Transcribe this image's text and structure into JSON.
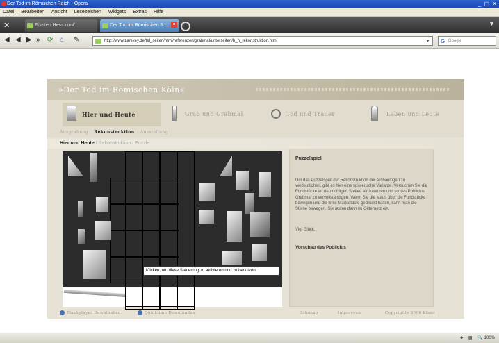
{
  "window": {
    "title": "Der Tod im Römischen Reich - Opera",
    "controls": "_ ▢ ✕"
  },
  "menubar": [
    "Datei",
    "Bearbeiten",
    "Ansicht",
    "Lesezeichen",
    "Widgets",
    "Extras",
    "Hilfe"
  ],
  "tabs": [
    {
      "label": "Fürsten Hess cont'"
    },
    {
      "label": "Der Tod im Römischen R..."
    }
  ],
  "addressbar": {
    "url": "http://www.zarskey.de/tel_seiten/html/referenzen/grabmal/unterseiten/h_h_rekonstruktion.html",
    "search_placeholder": "Google",
    "search_logo": "G"
  },
  "site": {
    "title": "»Der Tod im Römischen Köln«",
    "nav": [
      {
        "label": "Hier und Heute",
        "icon": "document-icon"
      },
      {
        "label": "Grab und Grabmal",
        "icon": "column-icon"
      },
      {
        "label": "Tod und Trauer",
        "icon": "wreath-icon"
      },
      {
        "label": "Leben und Leute",
        "icon": "figure-icon"
      }
    ],
    "subnav": [
      "Ausgrabung",
      "Rekonstruktion",
      "Ausstellung"
    ],
    "breadcrumb": {
      "current": "Hier und Heute",
      "rest": " / Rekonstruktion / Puzzle"
    },
    "tooltip": "Klicken, um diese Steuerung zu aktivieren und zu benutzen.",
    "info": {
      "heading": "Puzzelspiel",
      "body": "Um das Puzzelspiel der Rekonstruktion der Archäologen zu verdeutlichen, gibt es hier eine spielerische Variante. Versuchen Sie die Fundstücke an den richtigen Stellen einzusetzen und so das Poblicius Grabmal zu vervollständigen. Wenn Sie die Maus über die Fundstücke bewegen und die linke Mausetaste gedrückt halten, kann man die Steine bewegen. Sie rasten dann im Gitternetz ein.",
      "closing": "Viel Glück.",
      "preview_link": "Vorschau des Poblicius"
    },
    "footer": {
      "flash": "Flashplayer Downloaden",
      "quicktime": "Quicktime Downloaden",
      "sitemap": "Sitemap",
      "impressum": "Impressum",
      "copyright": "Copyrights 2006 Kised"
    }
  },
  "statusbar": {
    "zoom": "100%"
  }
}
